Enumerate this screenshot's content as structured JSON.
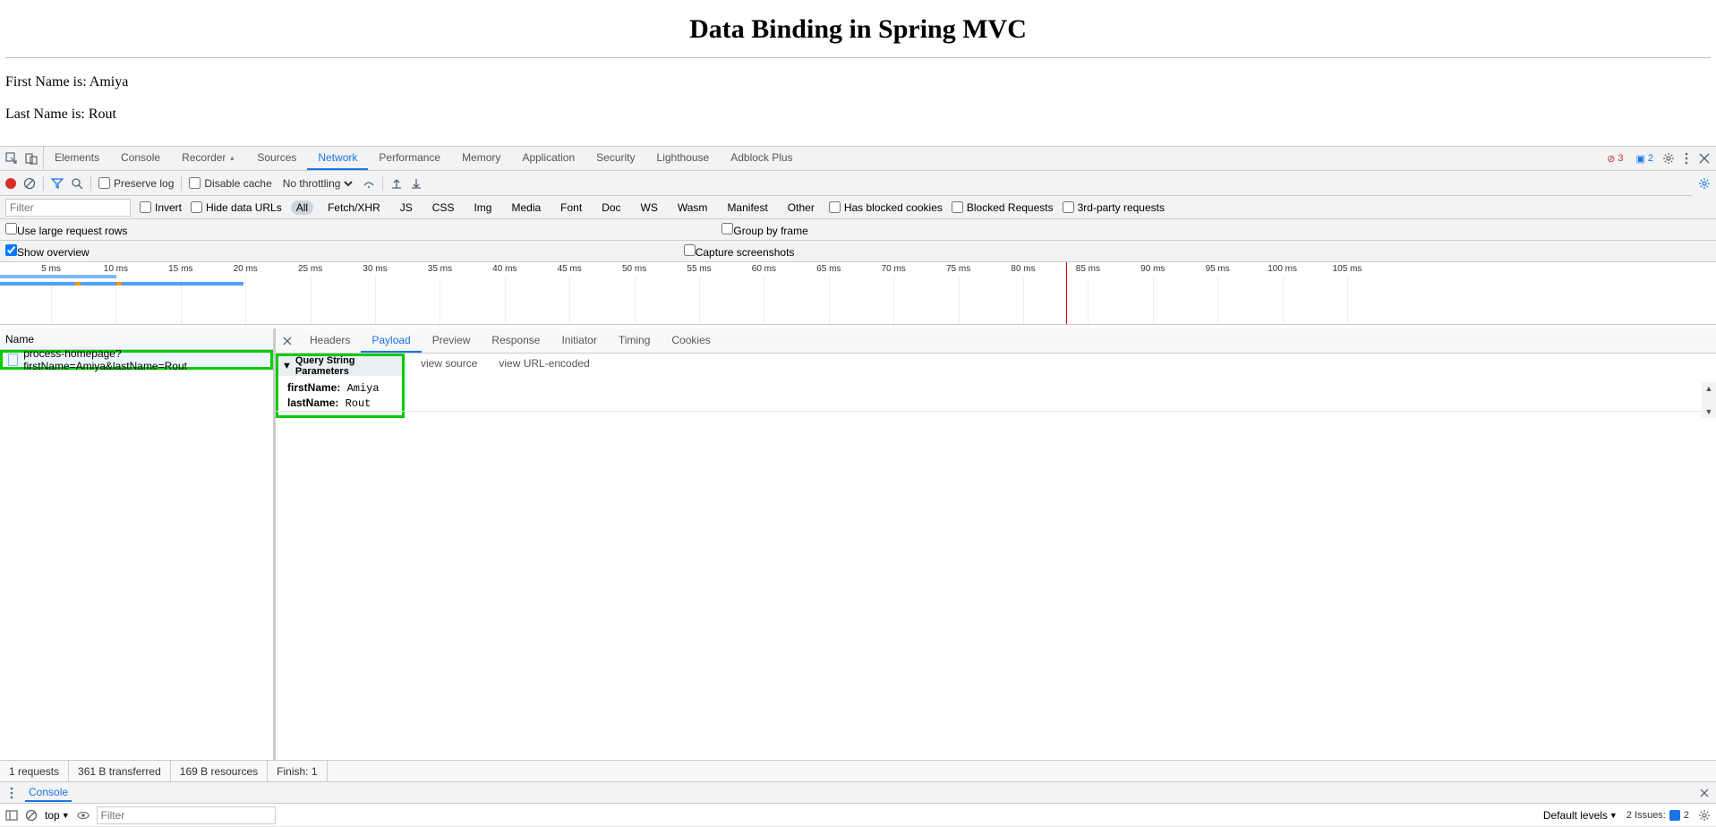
{
  "page": {
    "title": "Data Binding in Spring MVC",
    "line1_label": "First Name is: ",
    "line1_value": "Amiya",
    "line2_label": "Last Name is: ",
    "line2_value": "Rout"
  },
  "devtools": {
    "tabs": [
      "Elements",
      "Console",
      "Recorder",
      "Sources",
      "Network",
      "Performance",
      "Memory",
      "Application",
      "Security",
      "Lighthouse",
      "Adblock Plus"
    ],
    "active_tab": "Network",
    "errors": "3",
    "warnings": "2"
  },
  "network_toolbar": {
    "preserve_log": "Preserve log",
    "disable_cache": "Disable cache",
    "throttling": "No throttling"
  },
  "filter_row": {
    "placeholder": "Filter",
    "invert": "Invert",
    "hide_data_urls": "Hide data URLs",
    "types": [
      "All",
      "Fetch/XHR",
      "JS",
      "CSS",
      "Img",
      "Media",
      "Font",
      "Doc",
      "WS",
      "Wasm",
      "Manifest",
      "Other"
    ],
    "active_type": "All",
    "has_blocked_cookies": "Has blocked cookies",
    "blocked_requests": "Blocked Requests",
    "third_party": "3rd-party requests"
  },
  "check_rows": {
    "use_large": "Use large request rows",
    "show_overview": "Show overview",
    "group_by_frame": "Group by frame",
    "capture_screenshots": "Capture screenshots"
  },
  "overview": {
    "ticks": [
      "5 ms",
      "10 ms",
      "15 ms",
      "20 ms",
      "25 ms",
      "30 ms",
      "35 ms",
      "40 ms",
      "45 ms",
      "50 ms",
      "55 ms",
      "60 ms",
      "65 ms",
      "70 ms",
      "75 ms",
      "80 ms",
      "85 ms",
      "90 ms",
      "95 ms",
      "100 ms",
      "105 ms"
    ]
  },
  "request_list": {
    "header": "Name",
    "row": "process-homepage?firstName=Amiya&lastName=Rout"
  },
  "detail_tabs": [
    "Headers",
    "Payload",
    "Preview",
    "Response",
    "Initiator",
    "Timing",
    "Cookies"
  ],
  "detail_active": "Payload",
  "payload": {
    "section": "Query String Parameters",
    "view_source": "view source",
    "view_urlencoded": "view URL-encoded",
    "params": [
      {
        "k": "firstName:",
        "v": "Amiya"
      },
      {
        "k": "lastName:",
        "v": "Rout"
      }
    ]
  },
  "net_status": {
    "requests": "1 requests",
    "transferred": "361 B transferred",
    "resources": "169 B resources",
    "finish": "Finish: 1"
  },
  "console_drawer": {
    "tab": "Console",
    "context": "top",
    "filter_placeholder": "Filter",
    "levels": "Default levels",
    "issues": "2 Issues:",
    "issues_count": "2"
  }
}
